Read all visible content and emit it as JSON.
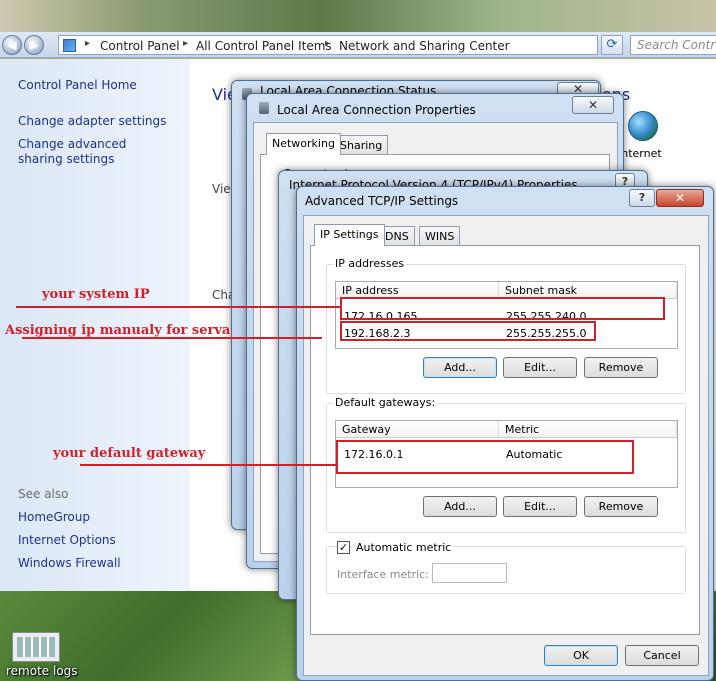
{
  "explorer": {
    "breadcrumbs": [
      "Control Panel",
      "All Control Panel Items",
      "Network and Sharing Center"
    ],
    "search_placeholder": "Search Control Panel",
    "left_pane": {
      "home": "Control Panel Home",
      "links": [
        "Change adapter settings",
        "Change advanced sharing settings"
      ],
      "see_also_label": "See also",
      "see_also": [
        "HomeGroup",
        "Internet Options",
        "Windows Firewall"
      ]
    },
    "main_fragments": {
      "view_top": "Vie",
      "ons": "ons",
      "view_mid": "View",
      "cha": "Cha",
      "internet": "Internet"
    }
  },
  "desktop": {
    "icon_label": "remote logs"
  },
  "dialogs": {
    "status": {
      "title": "Local Area Connection Status"
    },
    "properties": {
      "title": "Local Area Connection Properties",
      "tabs": [
        "Networking",
        "Sharing"
      ],
      "connect_using": "Connect using:",
      "t_label": "T"
    },
    "ipv4": {
      "title": "Internet Protocol Version 4 (TCP/IPv4) Properties"
    },
    "advanced": {
      "title": "Advanced TCP/IP Settings",
      "tabs": [
        "IP Settings",
        "DNS",
        "WINS"
      ],
      "ip_group": {
        "title": "IP addresses",
        "columns": [
          "IP address",
          "Subnet mask"
        ],
        "rows": [
          {
            "ip": "172.16.0.165",
            "mask": "255.255.240.0"
          },
          {
            "ip": "192.168.2.3",
            "mask": "255.255.255.0"
          }
        ],
        "buttons": [
          "Add...",
          "Edit...",
          "Remove"
        ]
      },
      "gw_group": {
        "title": "Default gateways:",
        "columns": [
          "Gateway",
          "Metric"
        ],
        "rows": [
          {
            "gateway": "172.16.0.1",
            "metric": "Automatic"
          }
        ],
        "buttons": [
          "Add...",
          "Edit...",
          "Remove"
        ]
      },
      "auto_metric": {
        "label": "Automatic metric",
        "checked": true
      },
      "interface_metric": {
        "label": "Interface metric:",
        "value": ""
      },
      "ok": "OK",
      "cancel": "Cancel"
    }
  },
  "annotations": {
    "system_ip": "your system IP",
    "manual_ip": "Assigning ip manualy for serva",
    "gateway": "your default gateway",
    "color": "#d0202a"
  }
}
